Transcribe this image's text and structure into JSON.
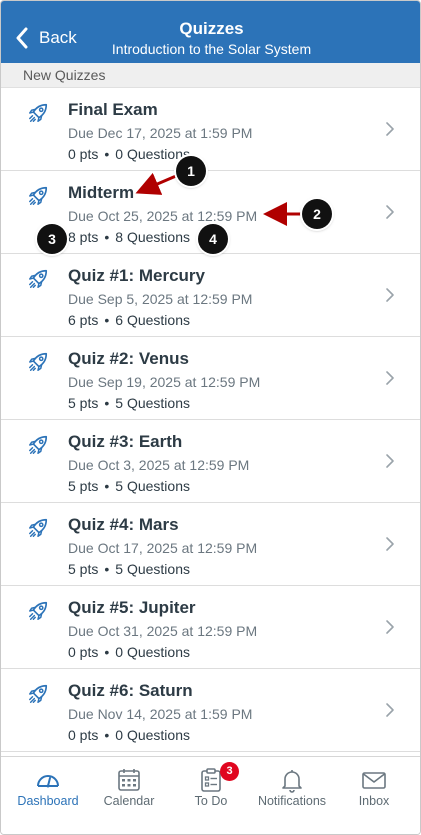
{
  "header": {
    "back_label": "Back",
    "title": "Quizzes",
    "subtitle": "Introduction to the Solar System"
  },
  "section_label": "New Quizzes",
  "quizzes": [
    {
      "name": "Final Exam",
      "due": "Due Dec 17, 2025 at 1:59 PM",
      "pts": "0 pts",
      "questions": "0 Questions"
    },
    {
      "name": "Midterm",
      "due": "Due Oct 25, 2025 at 12:59 PM",
      "pts": "8 pts",
      "questions": "8 Questions"
    },
    {
      "name": "Quiz #1: Mercury",
      "due": "Due Sep 5, 2025 at 12:59 PM",
      "pts": "6 pts",
      "questions": "6 Questions"
    },
    {
      "name": "Quiz #2: Venus",
      "due": "Due Sep 19, 2025 at 12:59 PM",
      "pts": "5 pts",
      "questions": "5 Questions"
    },
    {
      "name": "Quiz #3: Earth",
      "due": "Due Oct 3, 2025 at 12:59 PM",
      "pts": "5 pts",
      "questions": "5 Questions"
    },
    {
      "name": "Quiz #4: Mars",
      "due": "Due Oct 17, 2025 at 12:59 PM",
      "pts": "5 pts",
      "questions": "5 Questions"
    },
    {
      "name": "Quiz #5: Jupiter",
      "due": "Due Oct 31, 2025 at 12:59 PM",
      "pts": "0 pts",
      "questions": "0 Questions"
    },
    {
      "name": "Quiz #6: Saturn",
      "due": "Due Nov 14, 2025 at 1:59 PM",
      "pts": "0 pts",
      "questions": "0 Questions"
    }
  ],
  "separator": "•",
  "tabs": [
    {
      "label": "Dashboard",
      "icon": "dashboard-icon"
    },
    {
      "label": "Calendar",
      "icon": "calendar-icon"
    },
    {
      "label": "To Do",
      "icon": "todo-icon",
      "badge": "3"
    },
    {
      "label": "Notifications",
      "icon": "bell-icon"
    },
    {
      "label": "Inbox",
      "icon": "inbox-icon"
    }
  ],
  "callouts": [
    "1",
    "2",
    "3",
    "4"
  ],
  "colors": {
    "header": "#2c73b8",
    "accent": "#2c73b8",
    "badge": "#e0061f",
    "arrow": "#b00000",
    "rocket": "#2c73b8"
  }
}
